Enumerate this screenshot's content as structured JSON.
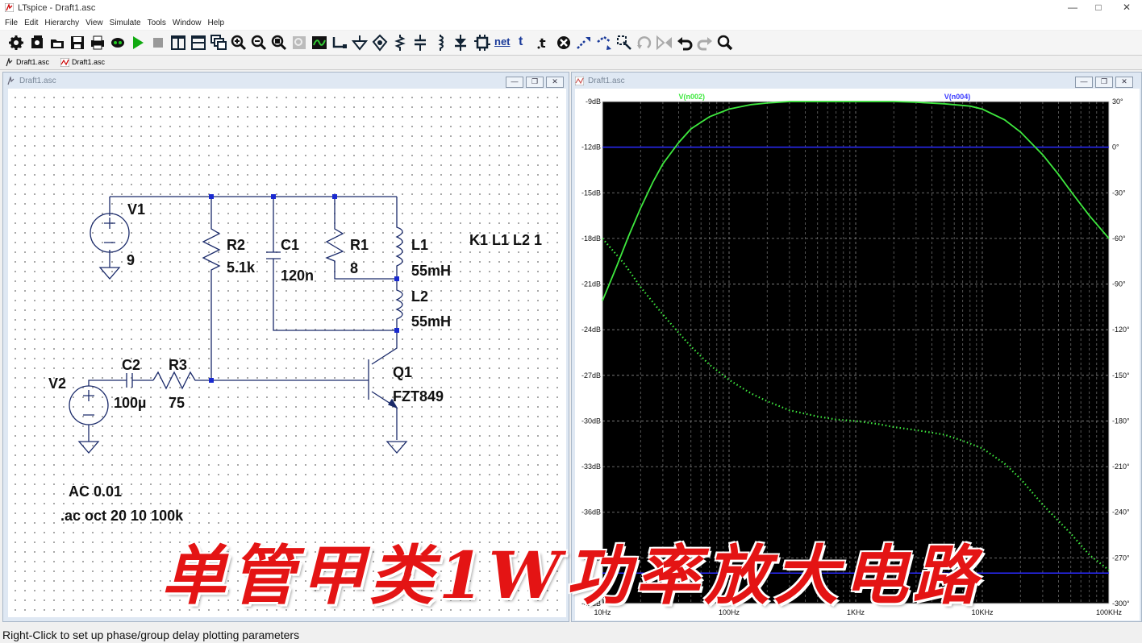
{
  "window": {
    "title": "LTspice - Draft1.asc"
  },
  "menu": [
    "File",
    "Edit",
    "Hierarchy",
    "View",
    "Simulate",
    "Tools",
    "Window",
    "Help"
  ],
  "toolbar": {
    "net_label": "net",
    "t_label": "t"
  },
  "tabs": [
    {
      "label": "Draft1.asc"
    },
    {
      "label": "Draft1.asc"
    }
  ],
  "schematic_window": {
    "title": "Draft1.asc"
  },
  "waveform_window": {
    "title": "Draft1.asc"
  },
  "schematic": {
    "v1_name": "V1",
    "v1_value": "9",
    "r2_name": "R2",
    "r2_value": "5.1k",
    "c1_name": "C1",
    "c1_value": "120n",
    "r1_name": "R1",
    "r1_value": "8",
    "l1_name": "L1",
    "l1_value": "55mH",
    "l2_name": "L2",
    "l2_value": "55mH",
    "coupling": "K1 L1 L2 1",
    "v2_name": "V2",
    "c2_name": "C2",
    "c2_value": "100µ",
    "r3_name": "R3",
    "r3_value": "75",
    "q1_name": "Q1",
    "q1_value": "FZT849",
    "ac_source": "AC 0.01",
    "sim_cmd": ".ac oct 20 10 100k"
  },
  "chart_data": {
    "type": "line",
    "x_scale": "log",
    "xlim": [
      10,
      100000
    ],
    "x_ticks": [
      "10Hz",
      "100Hz",
      "1KHz",
      "10KHz",
      "100KHz"
    ],
    "x_tick_values": [
      10,
      100,
      1000,
      10000,
      100000
    ],
    "ylim_left": [
      -42,
      -9
    ],
    "y_ticks_left": [
      "-9dB",
      "-12dB",
      "-15dB",
      "-18dB",
      "-21dB",
      "-24dB",
      "-27dB",
      "-30dB",
      "-33dB",
      "-36dB",
      "-39dB",
      "-42dB"
    ],
    "ylim_right": [
      -300,
      30
    ],
    "y_ticks_right": [
      "30°",
      "0°",
      "-30°",
      "-60°",
      "-90°",
      "-120°",
      "-150°",
      "-180°",
      "-210°",
      "-240°",
      "-270°",
      "-300°"
    ],
    "grid": true,
    "series": [
      {
        "name": "V(n002)",
        "kind": "magnitude_dB",
        "color": "#3ee83e",
        "x": [
          10,
          13,
          16,
          20,
          25,
          30,
          40,
          50,
          70,
          100,
          150,
          200,
          300,
          500,
          1000,
          2000,
          3000,
          5000,
          8000,
          10000,
          15000,
          20000,
          30000,
          40000,
          50000,
          70000,
          100000
        ],
        "y": [
          -22.1,
          -19.8,
          -17.9,
          -16.0,
          -14.3,
          -13.1,
          -11.7,
          -10.8,
          -10.0,
          -9.5,
          -9.2,
          -9.1,
          -9.0,
          -9.0,
          -9.0,
          -9.0,
          -9.05,
          -9.15,
          -9.3,
          -9.5,
          -10.2,
          -11.0,
          -12.5,
          -13.8,
          -14.9,
          -16.5,
          -18.0
        ]
      },
      {
        "name": "V(n004)",
        "kind": "phase_deg",
        "color": "#3ee83e",
        "x": [
          10,
          15,
          20,
          30,
          40,
          50,
          70,
          100,
          150,
          200,
          300,
          500,
          700,
          1000,
          1500,
          2000,
          3000,
          5000,
          7000,
          10000,
          15000,
          20000,
          30000,
          50000,
          70000,
          100000
        ],
        "y": [
          -60,
          -77,
          -92,
          -110,
          -122,
          -131,
          -143,
          -153,
          -162,
          -167,
          -173,
          -177,
          -179,
          -180,
          -182,
          -184,
          -186,
          -189,
          -193,
          -198,
          -208,
          -218,
          -235,
          -254,
          -268,
          -278
        ]
      }
    ],
    "ref_lines": [
      {
        "axis": "left",
        "value": -12,
        "color": "#2a2aff"
      },
      {
        "axis": "left",
        "value": -40,
        "color": "#2a2aff"
      }
    ],
    "legend_position": "top",
    "background": "#000000"
  },
  "overlay": {
    "caption": "单管甲类1W功率放大电路"
  },
  "status": {
    "text": "Right-Click to set up phase/group delay plotting parameters"
  }
}
